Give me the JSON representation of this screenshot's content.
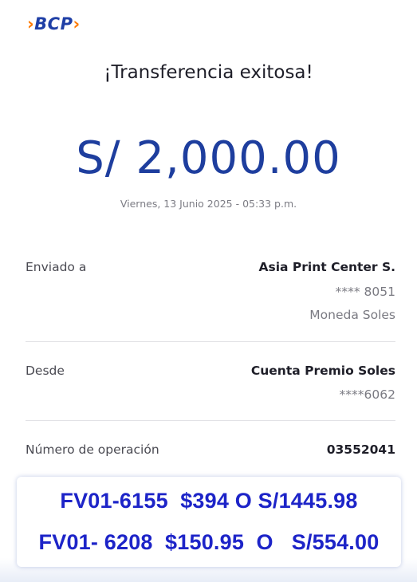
{
  "brand": {
    "logo_text": "BCP",
    "logo_chevron_left": "›",
    "logo_chevron_right": "›",
    "color_primary": "#1f3fa6",
    "color_accent": "#ff7a00"
  },
  "confirmation": {
    "title": "¡Transferencia exitosa!",
    "amount": "S/ 2,000.00",
    "datetime": "Viernes, 13 Junio 2025 - 05:33 p.m."
  },
  "details": {
    "recipient": {
      "label": "Enviado a",
      "name": "Asia Print Center S.",
      "account": "**** 8051",
      "currency": "Moneda Soles"
    },
    "source": {
      "label": "Desde",
      "account_name": "Cuenta Premio Soles",
      "account": "****6062"
    },
    "operation": {
      "label": "Número de operación",
      "number": "03552041"
    }
  },
  "annotation": {
    "line1": "FV01-6155  $394 O S/1445.98",
    "line2": "FV01- 6208  $150.95  O   S/554.00",
    "color": "#1d24c8"
  }
}
